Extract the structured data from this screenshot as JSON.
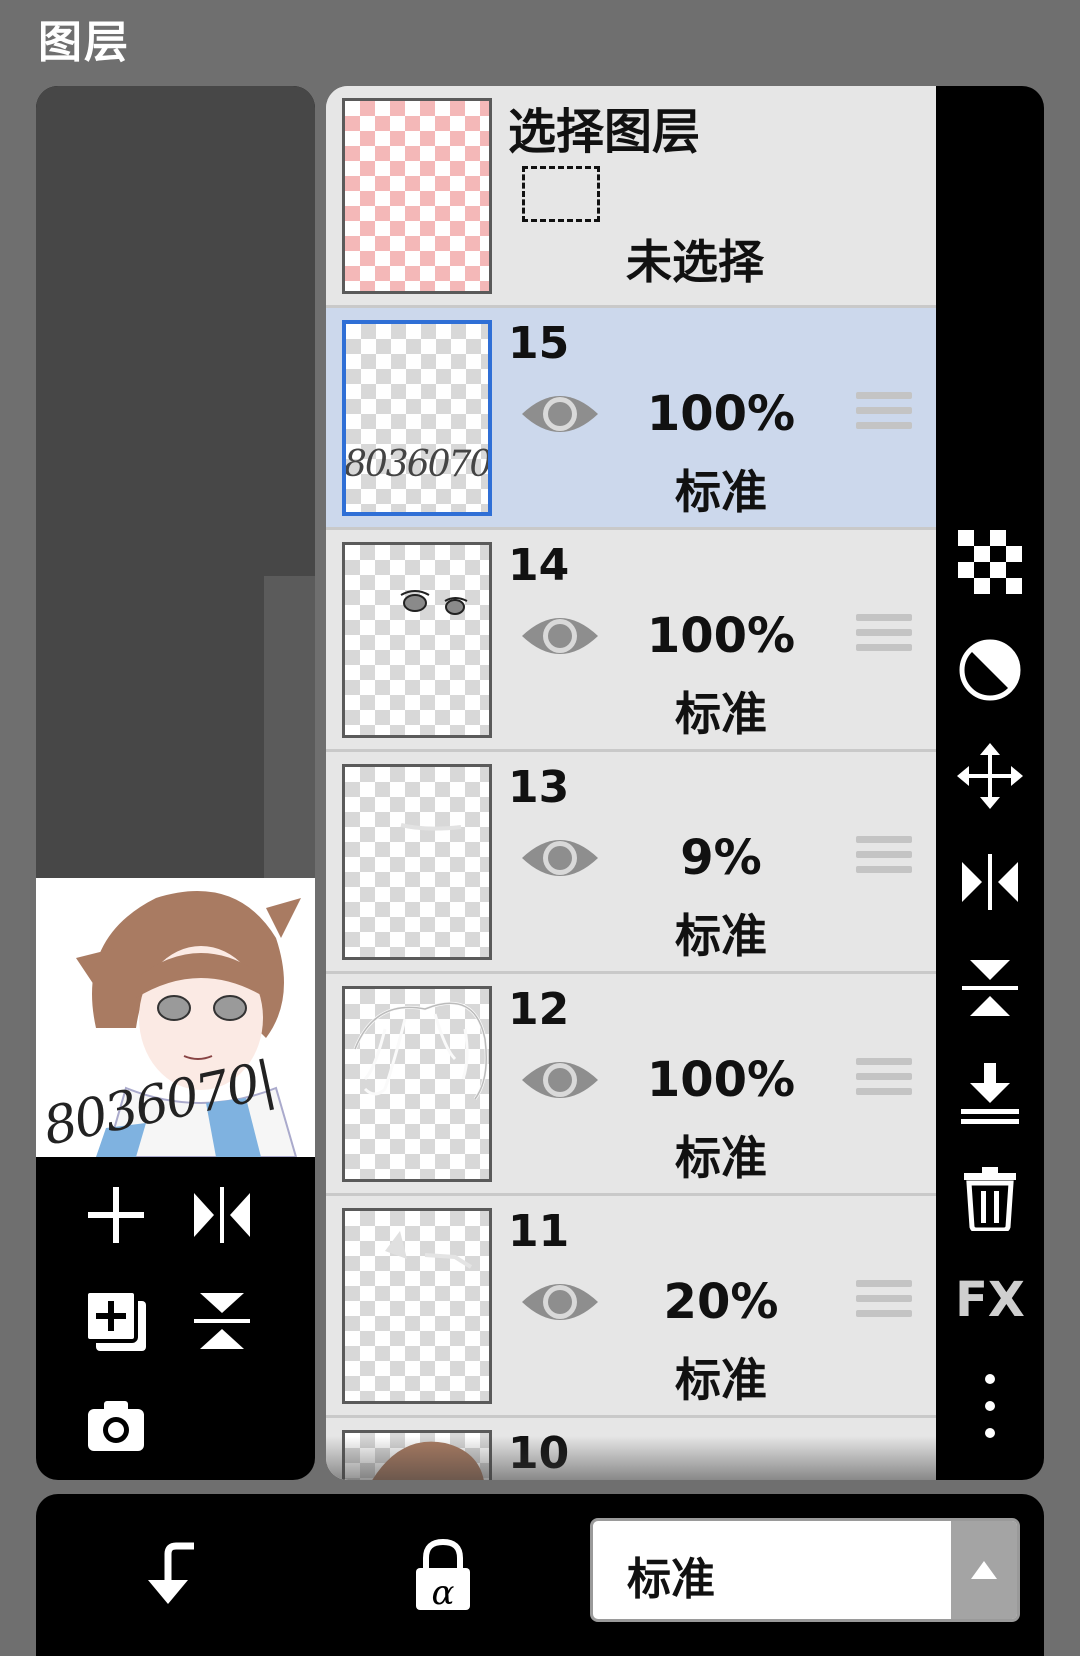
{
  "window": {
    "title": "图层"
  },
  "selection_layer": {
    "title": "选择图层",
    "status": "未选择"
  },
  "layers": [
    {
      "number": "15",
      "opacity": "100%",
      "blend": "标准",
      "selected": true,
      "thumb_text": "8036070|"
    },
    {
      "number": "14",
      "opacity": "100%",
      "blend": "标准",
      "selected": false
    },
    {
      "number": "13",
      "opacity": "9%",
      "blend": "标准",
      "selected": false
    },
    {
      "number": "12",
      "opacity": "100%",
      "blend": "标准",
      "selected": false
    },
    {
      "number": "11",
      "opacity": "20%",
      "blend": "标准",
      "selected": false
    },
    {
      "number": "10"
    }
  ],
  "preview": {
    "watermark": "8036070|"
  },
  "left_tools": [
    "add-layer-icon",
    "flip-horizontal-icon",
    "duplicate-layer-icon",
    "flip-vertical-icon",
    "camera-icon"
  ],
  "right_tools": [
    "transparency-icon",
    "invert-icon",
    "move-icon",
    "flip-horizontal-icon",
    "flip-vertical-icon",
    "merge-down-icon",
    "delete-icon",
    "fx-icon",
    "more-icon"
  ],
  "right_tools_fx_label": "FX",
  "bottom_bar": {
    "clip_icon": "clip-icon",
    "alpha_lock_icon": "alpha-lock-icon",
    "blend_mode": "标准"
  },
  "colors": {
    "selected_row": "#ccd8ec",
    "selected_border": "#2f6fd6",
    "panel_bg": "#000000"
  }
}
